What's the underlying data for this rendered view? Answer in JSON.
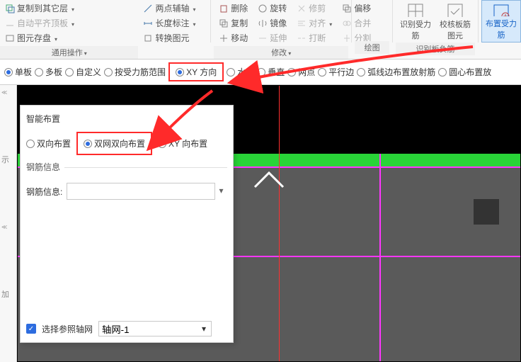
{
  "ribbon": {
    "row1": {
      "copy_to_other": "复制到其它层",
      "two_point_aux": "两点辅轴",
      "delete": "删除",
      "rotate": "旋转",
      "trim": "修剪",
      "offset": "偏移"
    },
    "row2": {
      "auto_flat_top": "自动平齐顶板",
      "length_dim": "长度标注",
      "copy": "复制",
      "mirror": "镜像",
      "align": "对齐",
      "merge": "合并"
    },
    "row3": {
      "entity_buffer": "图元存盘",
      "convert_entity": "转换图元",
      "move": "移动",
      "extend": "延伸",
      "break": "打断",
      "split": "分割"
    },
    "sec1_label": "通用操作",
    "sec2_label": "修改",
    "sec3_label": "绘图",
    "sec4_label": "识别板负筋",
    "big_recognize": "识别受力筋",
    "big_check": "校核板筋图元",
    "big_place": "布置受力筋"
  },
  "options": {
    "single": "单板",
    "multi": "多板",
    "custom": "自定义",
    "by_force": "按受力筋范围",
    "xy_direction": "XY 方向",
    "horizontal": "水平",
    "vertical": "垂直",
    "two_points": "两点",
    "parallel_edge": "平行边",
    "arc_radial": "弧线边布置放射筋",
    "circle_center": "圆心布置放"
  },
  "panel": {
    "title": "智能布置",
    "rb_two_way": "双向布置",
    "rb_double_net": "双网双向布置",
    "rb_xy_way": "XY 向布置",
    "group_label": "钢筋信息",
    "info_label": "钢筋信息:",
    "info_value": "",
    "chk_ref_grid": "选择参照轴网",
    "grid_value": "轴网-1"
  },
  "left_gutter": {
    "mark1": "示",
    "mark2": "加"
  }
}
